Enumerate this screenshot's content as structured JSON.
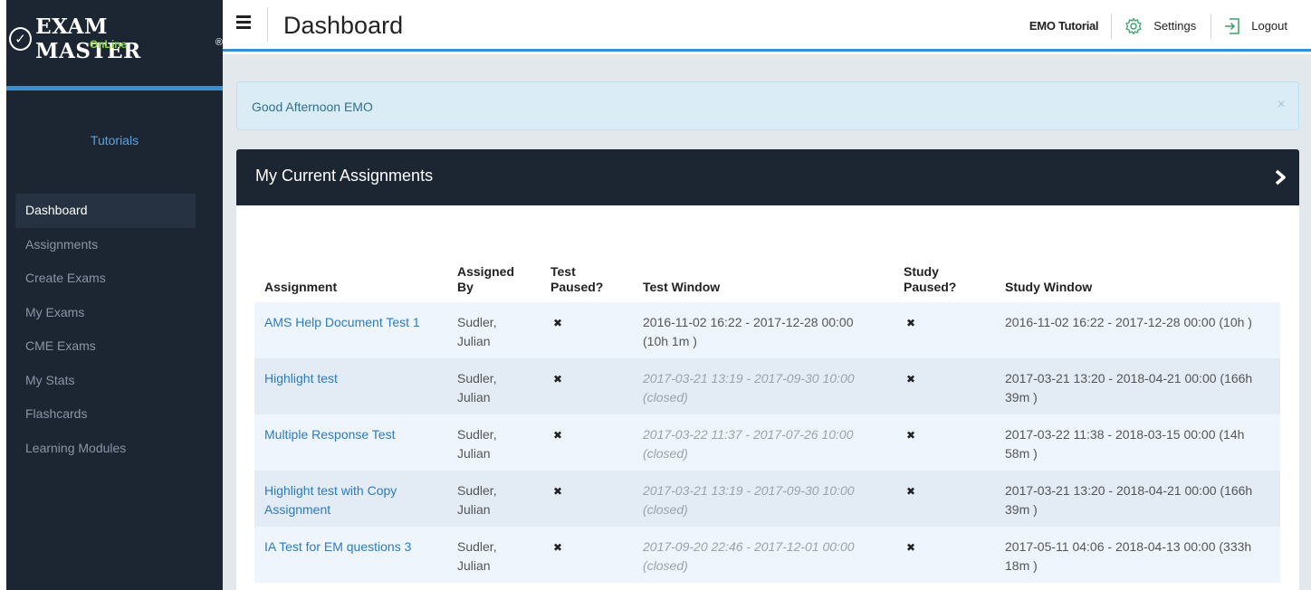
{
  "brand": {
    "name": "EXAM MASTER",
    "registered": "®",
    "subtitle": "OnLine"
  },
  "sidebar": {
    "section_label": "Tutorials",
    "items": [
      {
        "label": "Dashboard",
        "active": true
      },
      {
        "label": "Assignments"
      },
      {
        "label": "Create Exams"
      },
      {
        "label": "My Exams"
      },
      {
        "label": "CME Exams"
      },
      {
        "label": "My Stats"
      },
      {
        "label": "Flashcards"
      },
      {
        "label": "Learning Modules"
      }
    ]
  },
  "header": {
    "title": "Dashboard",
    "user": "EMO Tutorial",
    "settings_label": "Settings",
    "logout_label": "Logout",
    "accent_color": "#3a8fd0"
  },
  "alert": {
    "message": "Good Afternoon EMO",
    "close_symbol": "×"
  },
  "assignments_panel": {
    "title": "My Current Assignments",
    "columns": {
      "assignment": "Assignment",
      "assigned_by_1": "Assigned",
      "assigned_by_2": "By",
      "test_paused_1": "Test",
      "test_paused_2": "Paused?",
      "test_window": "Test Window",
      "study_paused_1": "Study",
      "study_paused_2": "Paused?",
      "study_window": "Study Window"
    },
    "paused_symbol": "✖",
    "rows": [
      {
        "assignment": "AMS Help Document Test 1",
        "assigned_by_1": "Sudler,",
        "assigned_by_2": "Julian",
        "test_window_1": "2016-11-02 16:22 - 2017-12-28 00:00",
        "test_window_2": "(10h 1m )",
        "study_window_1": "2016-11-02 16:22 - 2017-12-28 00:00 (10h )",
        "study_window_2": ""
      },
      {
        "assignment": "Highlight test",
        "assigned_by_1": "Sudler,",
        "assigned_by_2": "Julian",
        "test_window_1": "2017-03-21 13:19 - 2017-09-30 10:00",
        "test_window_2": "(closed)",
        "study_window_1": "2017-03-21 13:20 - 2018-04-21 00:00 (166h",
        "study_window_2": "39m )"
      },
      {
        "assignment": "Multiple Response Test",
        "assigned_by_1": "Sudler,",
        "assigned_by_2": "Julian",
        "test_window_1": "2017-03-22 11:37 - 2017-07-26 10:00",
        "test_window_2": "(closed)",
        "study_window_1": "2017-03-22 11:38 - 2018-03-15 00:00 (14h",
        "study_window_2": "58m )"
      },
      {
        "assignment_1": "Highlight test with Copy",
        "assignment_2": "Assignment",
        "assigned_by_1": "Sudler,",
        "assigned_by_2": "Julian",
        "test_window_1": "2017-03-21 13:19 - 2017-09-30 10:00",
        "test_window_2": "(closed)",
        "study_window_1": "2017-03-21 13:20 - 2018-04-21 00:00 (166h",
        "study_window_2": "39m )"
      },
      {
        "assignment": "IA Test for EM questions 3",
        "assigned_by_1": "Sudler,",
        "assigned_by_2": "Julian",
        "test_window_1": "2017-09-20 22:46 - 2017-12-01 00:00",
        "test_window_2": "(closed)",
        "study_window_1": "2017-05-11 04:06 - 2018-04-13 00:00 (333h",
        "study_window_2": "18m )"
      }
    ]
  }
}
